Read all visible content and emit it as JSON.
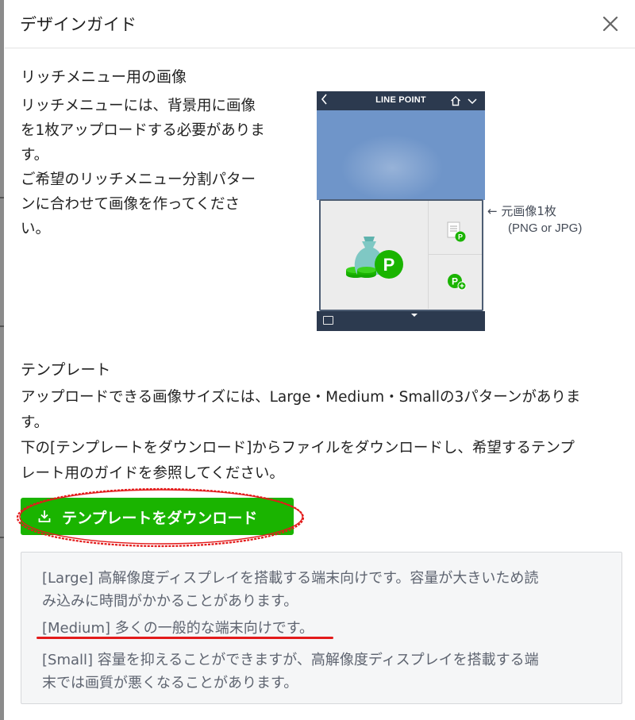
{
  "dialog": {
    "title": "デザインガイド",
    "close_icon": "close-icon"
  },
  "rich_menu": {
    "title": "リッチメニュー用の画像",
    "desc_lines": [
      "リッチメニューには、背景用に画像",
      "を1枚アップロードする必要がありま",
      "す。",
      "ご希望のリッチメニュー分割パター",
      "ンに合わせて画像を作ってくださ",
      "い。"
    ],
    "phone": {
      "header_title": "LINE POINT",
      "back_icon": "chevron-left-icon",
      "home_icon": "home-icon",
      "chevron_icon": "chevron-down-icon",
      "keyboard_icon": "keyboard-icon",
      "colors": {
        "bar": "#2c3a4f",
        "sky": "#6f95c9",
        "menu_bg": "#ececec",
        "green": "#1ab400"
      }
    },
    "callout_line1": "← 元画像1枚",
    "callout_line2": "(PNG or JPG)"
  },
  "template": {
    "title": "テンプレート",
    "desc_lines": [
      "アップロードできる画像サイズには、Large・Medium・Smallの3パターンがありま",
      "す。",
      "下の[テンプレートをダウンロード]からファイルをダウンロードし、希望するテンプ",
      "レート用のガイドを参照してください。"
    ],
    "download_label": "テンプレートをダウンロード",
    "download_icon": "download-icon",
    "button_color": "#1ab400",
    "highlight_color": "#e31b1b"
  },
  "info": {
    "lines": [
      "[Large] 高解像度ディスプレイを搭載する端末向けです。容量が大きいため読",
      "み込みに時間がかかることがあります。",
      "[Medium] 多くの一般的な端末向けです。",
      "[Small] 容量を抑えることができますが、高解像度ディスプレイを搭載する端",
      "末では画質が悪くなることがあります。"
    ]
  }
}
